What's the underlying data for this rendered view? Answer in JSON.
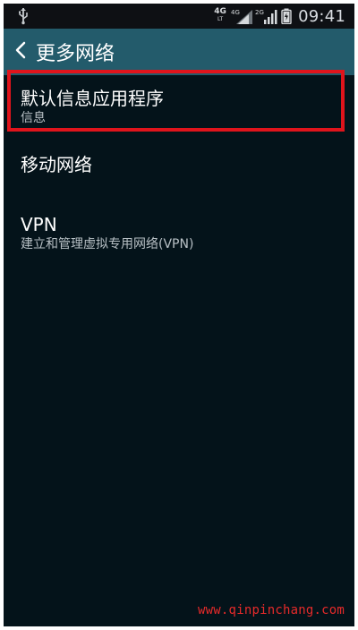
{
  "status_bar": {
    "time": "09:41",
    "network_badges": [
      {
        "top": "4G",
        "sub": "LT"
      },
      {
        "top": "4G",
        "sub": ""
      },
      {
        "top": "2G",
        "sub": ""
      }
    ],
    "icons": {
      "usb": "usb-icon",
      "signal": "signal-icon",
      "battery": "battery-icon"
    }
  },
  "header": {
    "title": "更多网络",
    "back_icon": "chevron-left-icon",
    "background": "#235b6b"
  },
  "settings": {
    "items": [
      {
        "title": "默认信息应用程序",
        "subtitle": "信息"
      },
      {
        "title": "移动网络",
        "subtitle": ""
      },
      {
        "title": "VPN",
        "subtitle": "建立和管理虚拟专用网络(VPN)"
      }
    ]
  },
  "annotation": {
    "highlight_color": "#e0141c",
    "watermark": "www.qinpinchang.com"
  }
}
